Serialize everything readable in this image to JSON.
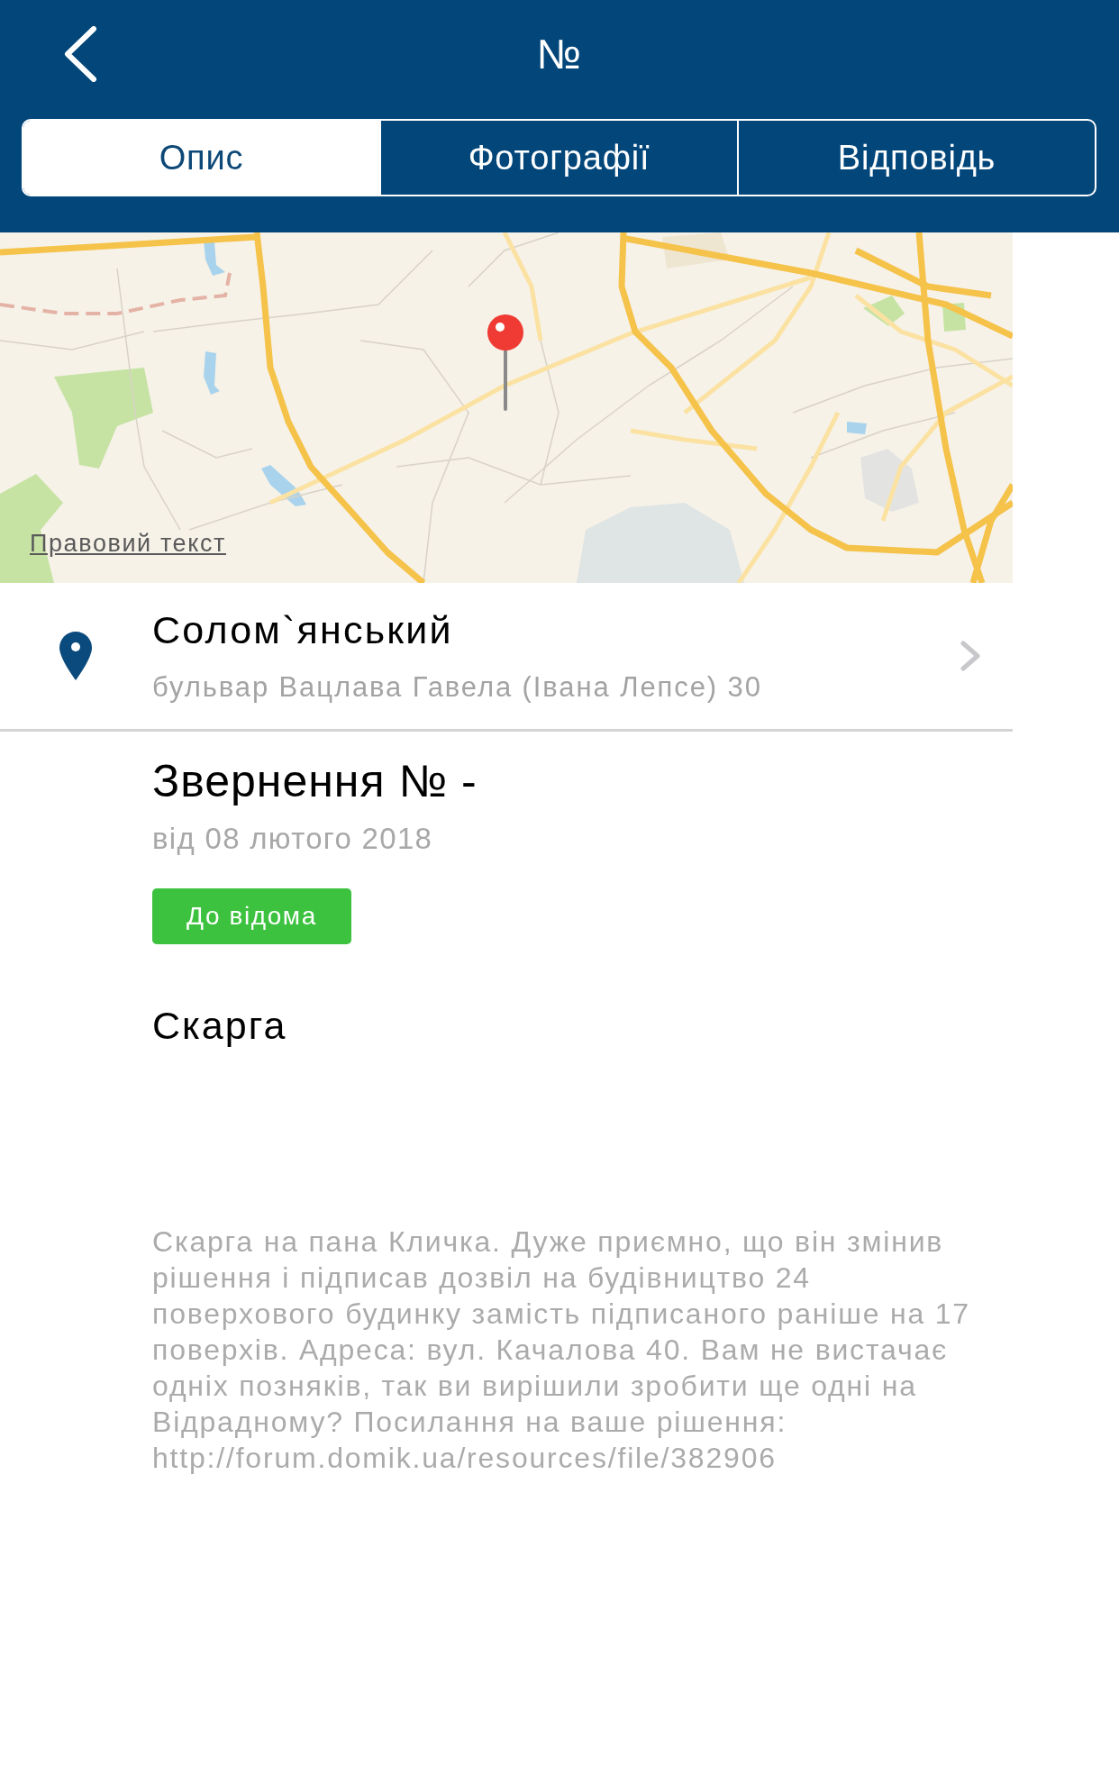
{
  "nav_bar": {
    "title": "№"
  },
  "tabs": [
    {
      "label": "Опис",
      "selected": true
    },
    {
      "label": "Фотографії",
      "selected": false
    },
    {
      "label": "Відповідь",
      "selected": false
    }
  ],
  "map": {
    "legal_link": "Правовий текст"
  },
  "location": {
    "title": "Солом`янський",
    "address": "бульвар Вацлава Гавела (Івана Лепсе) 30"
  },
  "appeal": {
    "title": "Звернення № -",
    "date": "від 08 лютого 2018",
    "status": "До відома",
    "category": "Скарга",
    "description": "Скарга на пана Кличка. Дуже приємно, що він змінив рішення і підписав дозвіл на будівництво 24 поверхового будинку замість підписаного раніше на 17 поверхів. Адреса: вул. Качалова 40. Вам не вистачає одніх позняків, так ви вирішили зробити ще одні на Відрадному? Посилання на ваше рішення: http://forum.domik.ua/resources/file/382906"
  }
}
